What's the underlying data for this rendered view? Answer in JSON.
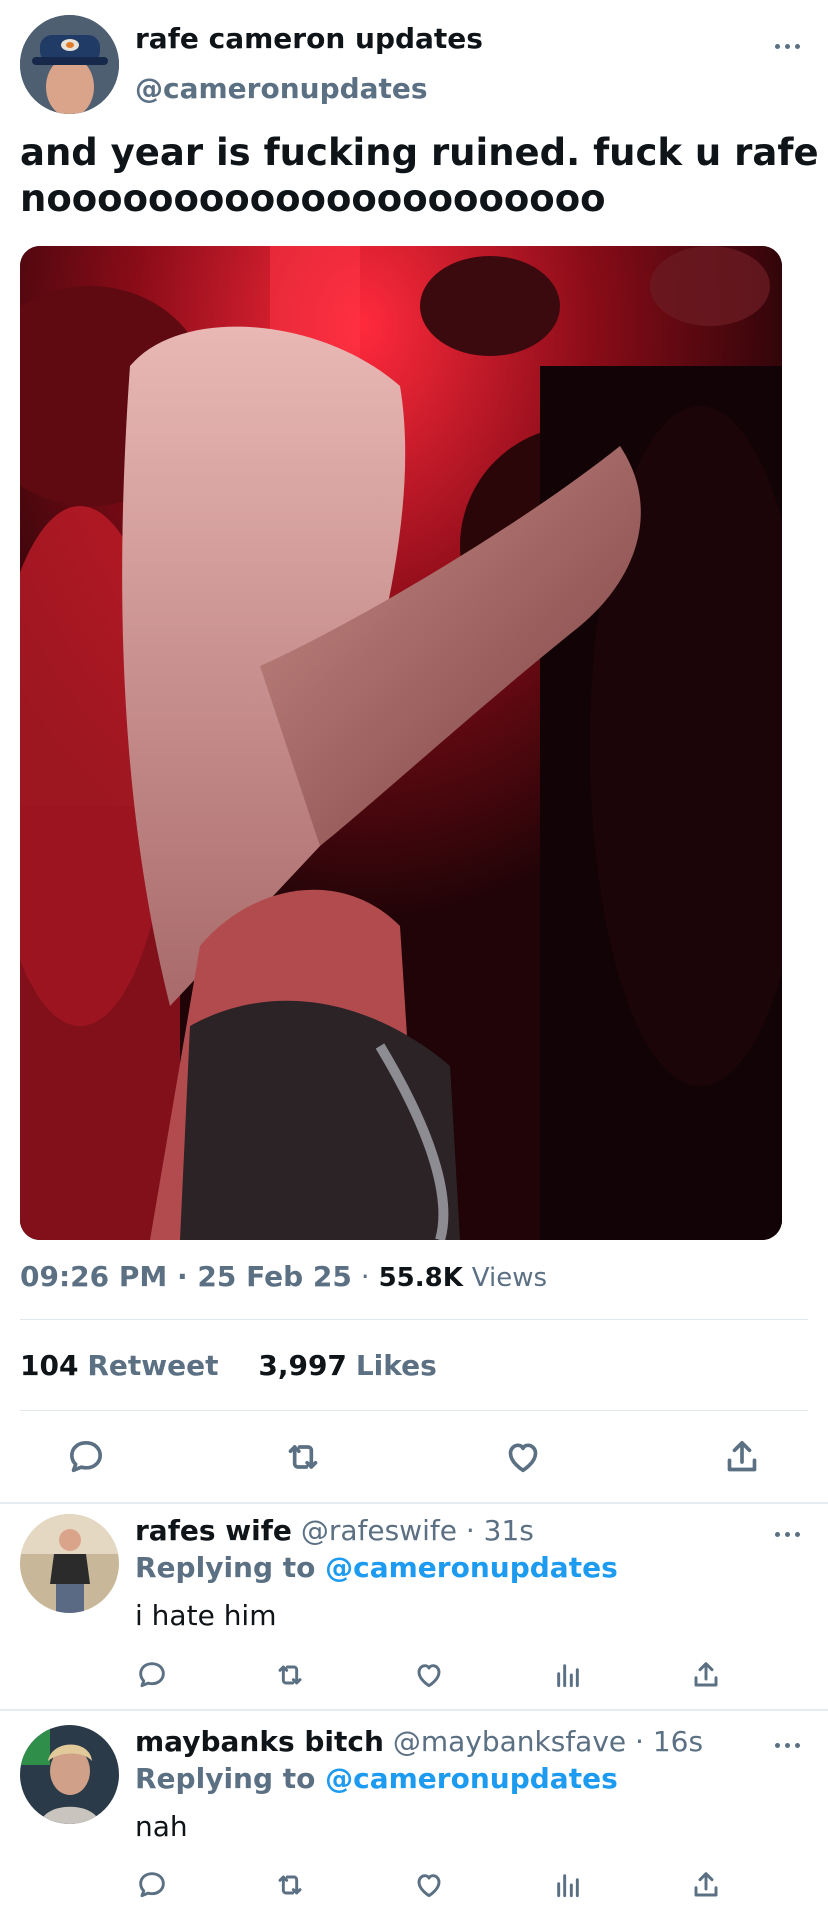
{
  "tweet": {
    "author_name": "rafe cameron updates",
    "author_handle": "@cameronupdates",
    "text_line1": "and year is fucking ruined. fuck u rafe",
    "text_line2": "noooooooooooooooooooooo",
    "time": "09:26 PM",
    "date": "25 Feb 25",
    "views_count": "55.8K",
    "views_label": "Views",
    "retweets_count": "104",
    "retweets_label": "Retweet",
    "likes_count": "3,997",
    "likes_label": "Likes"
  },
  "replies": [
    {
      "name": "rafes wife",
      "meta": "@rafeswife · 31s",
      "replying_label": "Replying to",
      "replying_handle": "@cameronupdates",
      "text": "i hate him"
    },
    {
      "name": "maybanks bitch",
      "meta": "@maybanksfave · 16s",
      "replying_label": "Replying to",
      "replying_handle": "@cameronupdates",
      "text": "nah"
    }
  ],
  "colors": {
    "accent": "#1d9bf0",
    "muted": "#5b7083",
    "text": "#0f1419"
  }
}
